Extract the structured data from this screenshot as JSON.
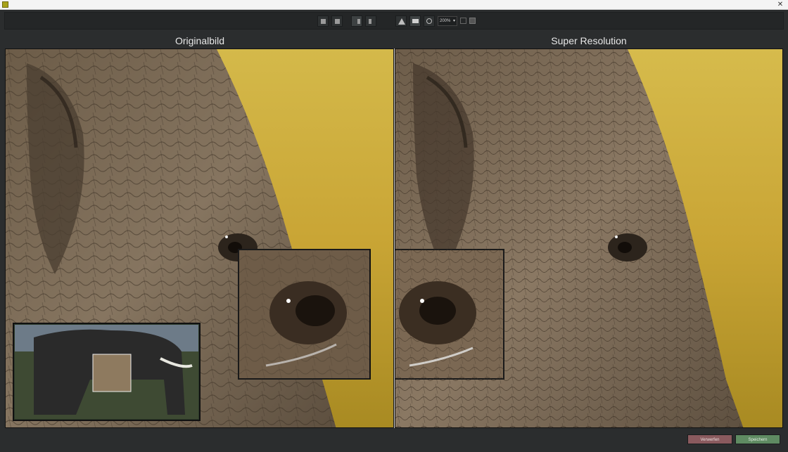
{
  "window": {
    "close_label": "✕"
  },
  "toolbar": {
    "zoom_value": "200%"
  },
  "panes": {
    "left_title": "Originalbild",
    "right_title": "Super Resolution"
  },
  "actions": {
    "discard_label": "Verwerfen",
    "save_label": "Speichern"
  },
  "colors": {
    "background": "#2b2d2e",
    "discard": "#8a5a5e",
    "save": "#5f8b62",
    "savanna": "#c9a535",
    "elephant_skin": "#7d6b55"
  }
}
